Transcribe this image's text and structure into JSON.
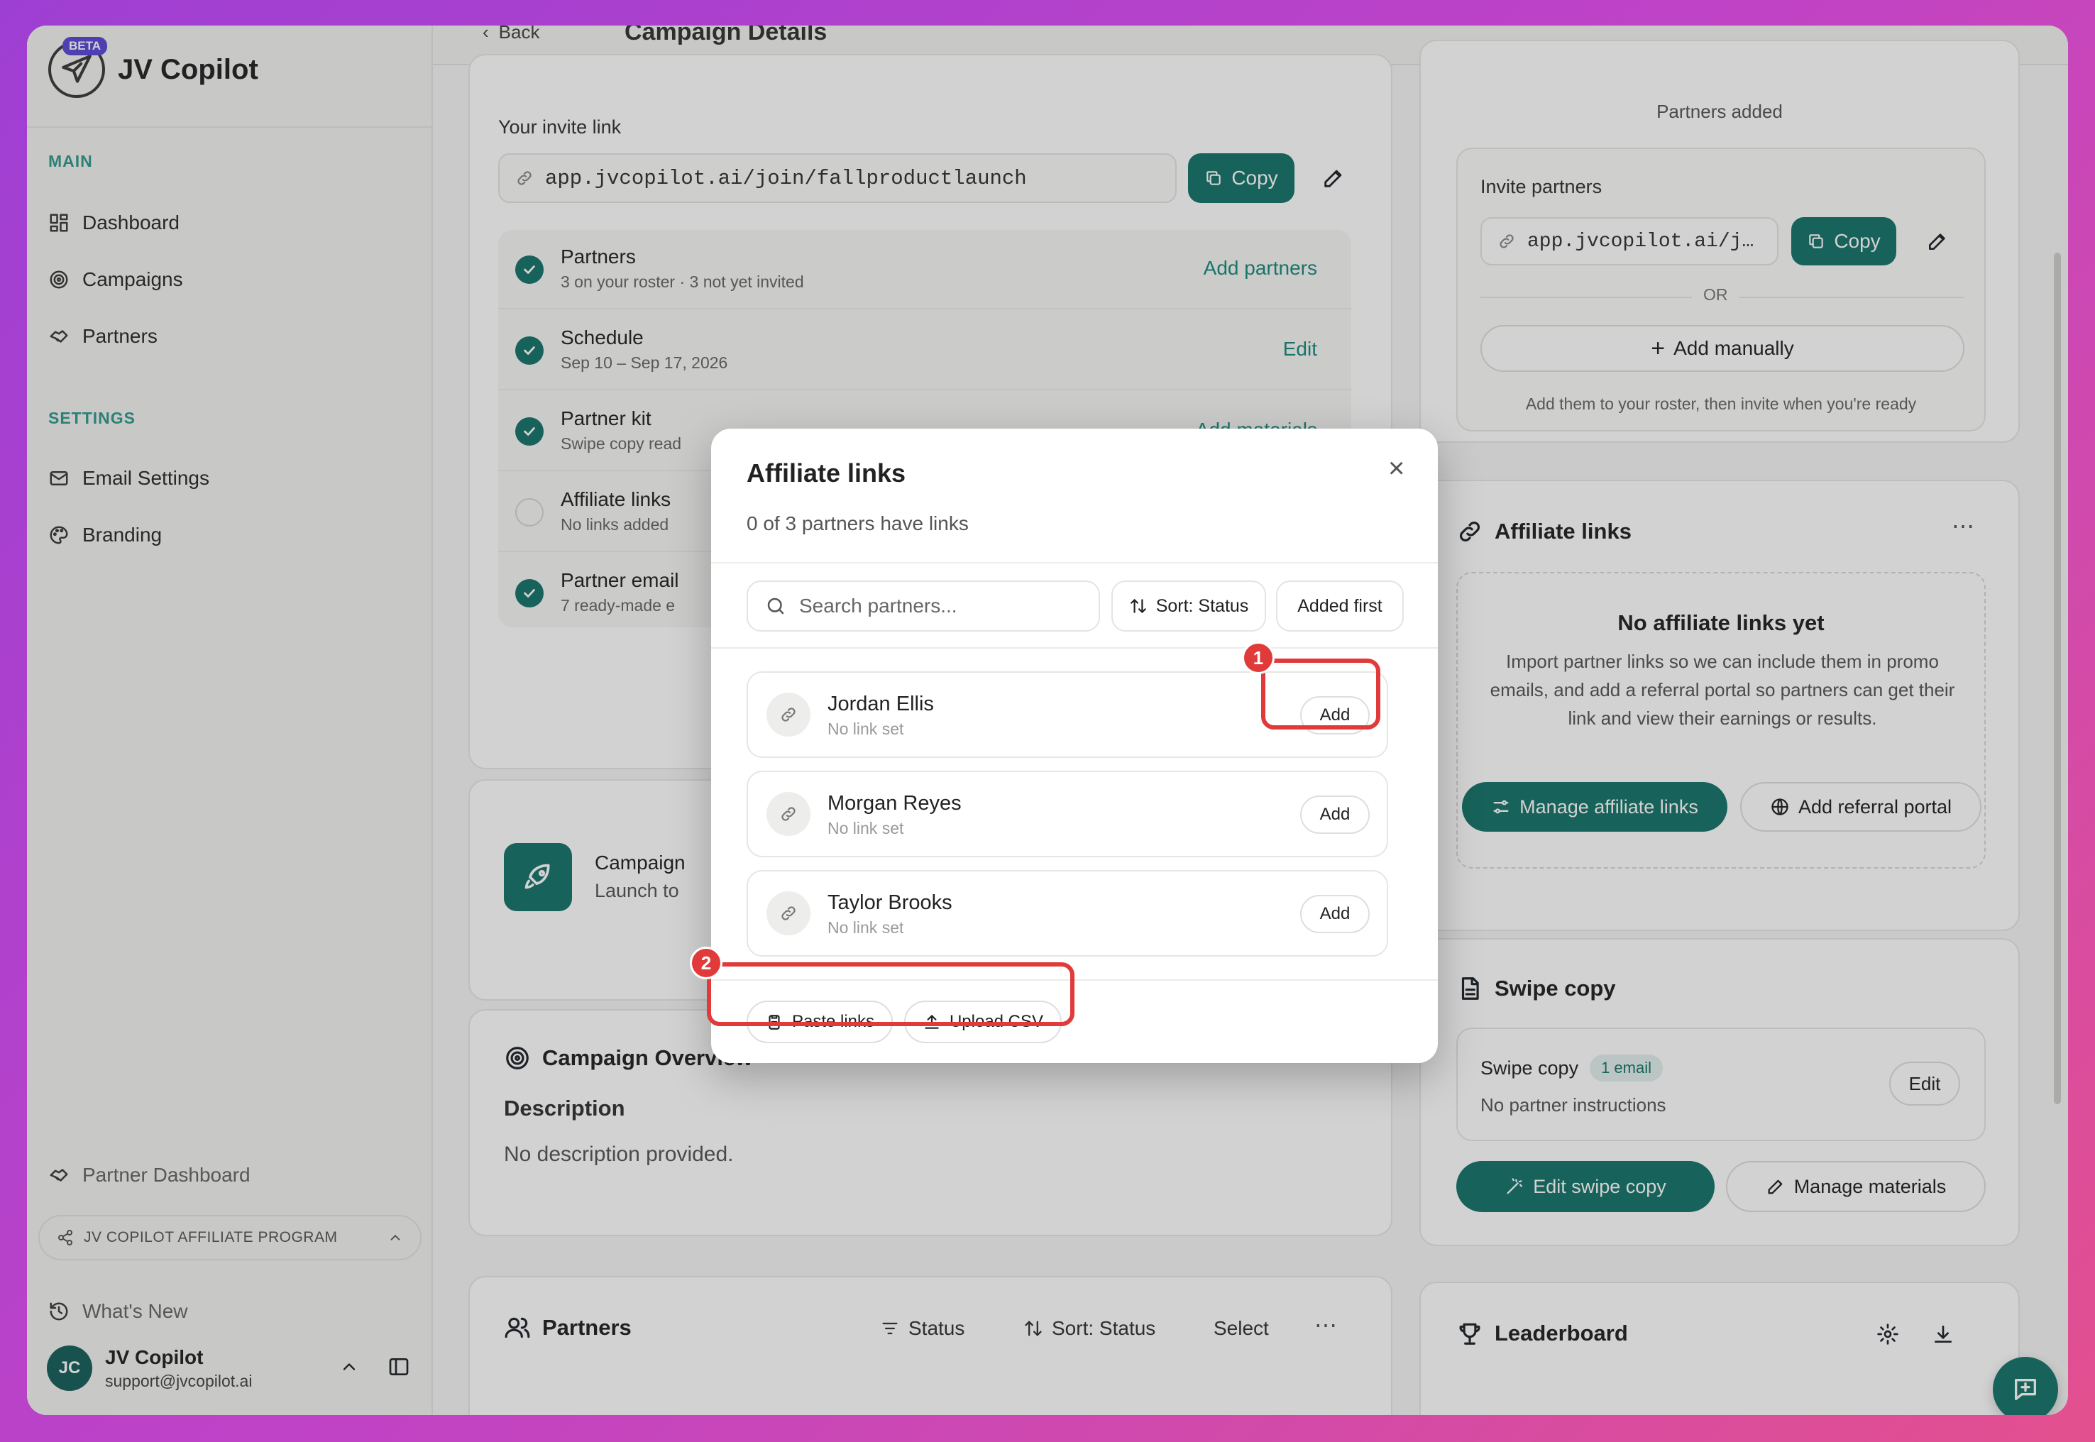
{
  "app": {
    "name": "JV Copilot",
    "beta": "BETA"
  },
  "sidebar": {
    "main_heading": "MAIN",
    "main_items": [
      {
        "label": "Dashboard"
      },
      {
        "label": "Campaigns"
      },
      {
        "label": "Partners"
      }
    ],
    "settings_heading": "SETTINGS",
    "settings_items": [
      {
        "label": "Email Settings"
      },
      {
        "label": "Branding"
      }
    ],
    "partner_dashboard": "Partner Dashboard",
    "affiliate_program": "JV COPILOT AFFILIATE PROGRAM",
    "whats_new": "What's New",
    "user": {
      "initials": "JC",
      "name": "JV Copilot",
      "email": "support@jvcopilot.ai"
    }
  },
  "topbar": {
    "back": "Back",
    "title": "Campaign Details"
  },
  "invite": {
    "label": "Your invite link",
    "url": "app.jvcopilot.ai/join/fallproductlaunch",
    "copy": "Copy"
  },
  "checklist": [
    {
      "title": "Partners",
      "sub": "3 on your roster · 3 not yet invited",
      "action": "Add partners",
      "done": true
    },
    {
      "title": "Schedule",
      "sub": "Sep 10 – Sep 17, 2026",
      "action": "Edit",
      "done": true
    },
    {
      "title": "Partner kit",
      "sub": "Swipe copy read",
      "action": "Add materials",
      "done": true
    },
    {
      "title": "Affiliate links",
      "sub": "No links added",
      "action": "",
      "done": false
    },
    {
      "title": "Partner email",
      "sub": "7 ready-made e",
      "action": "",
      "done": true
    }
  ],
  "campaign_card": {
    "title": "Campaign",
    "sub": "Launch to"
  },
  "overview": {
    "title": "Campaign Overview",
    "desc_label": "Description",
    "desc": "No description provided."
  },
  "partners_section": {
    "title": "Partners",
    "status": "Status",
    "sort": "Sort: Status",
    "select": "Select"
  },
  "right": {
    "partners_added": "Partners added",
    "invite_title": "Invite partners",
    "invite_url": "app.jvcopilot.ai/j…",
    "copy": "Copy",
    "or": "OR",
    "add_manually": "Add manually",
    "roster_note": "Add them to your roster, then invite when you're ready",
    "aff_title": "Affiliate links",
    "aff_empty_title": "No affiliate links yet",
    "aff_empty_desc": "Import partner links so we can include them in promo emails, and add a referral portal so partners can get their link and view their earnings or results.",
    "manage_links": "Manage affiliate links",
    "add_portal": "Add referral portal",
    "swipe_title": "Swipe copy",
    "swipe_label": "Swipe copy",
    "swipe_badge": "1 email",
    "swipe_note": "No partner instructions",
    "edit": "Edit",
    "edit_swipe": "Edit swipe copy",
    "manage_materials": "Manage materials",
    "leaderboard": "Leaderboard"
  },
  "modal": {
    "title": "Affiliate links",
    "subtitle": "0 of 3 partners have links",
    "search_placeholder": "Search partners...",
    "sort": "Sort: Status",
    "order": "Added first",
    "partners": [
      {
        "name": "Jordan Ellis",
        "status": "No link set",
        "action": "Add"
      },
      {
        "name": "Morgan Reyes",
        "status": "No link set",
        "action": "Add"
      },
      {
        "name": "Taylor Brooks",
        "status": "No link set",
        "action": "Add"
      }
    ],
    "paste_links": "Paste links",
    "upload_csv": "Upload CSV"
  },
  "annotations": [
    "1",
    "2"
  ],
  "colors": {
    "accent": "#16746a",
    "highlight": "#e03a3a",
    "beta": "#5b49d6"
  }
}
